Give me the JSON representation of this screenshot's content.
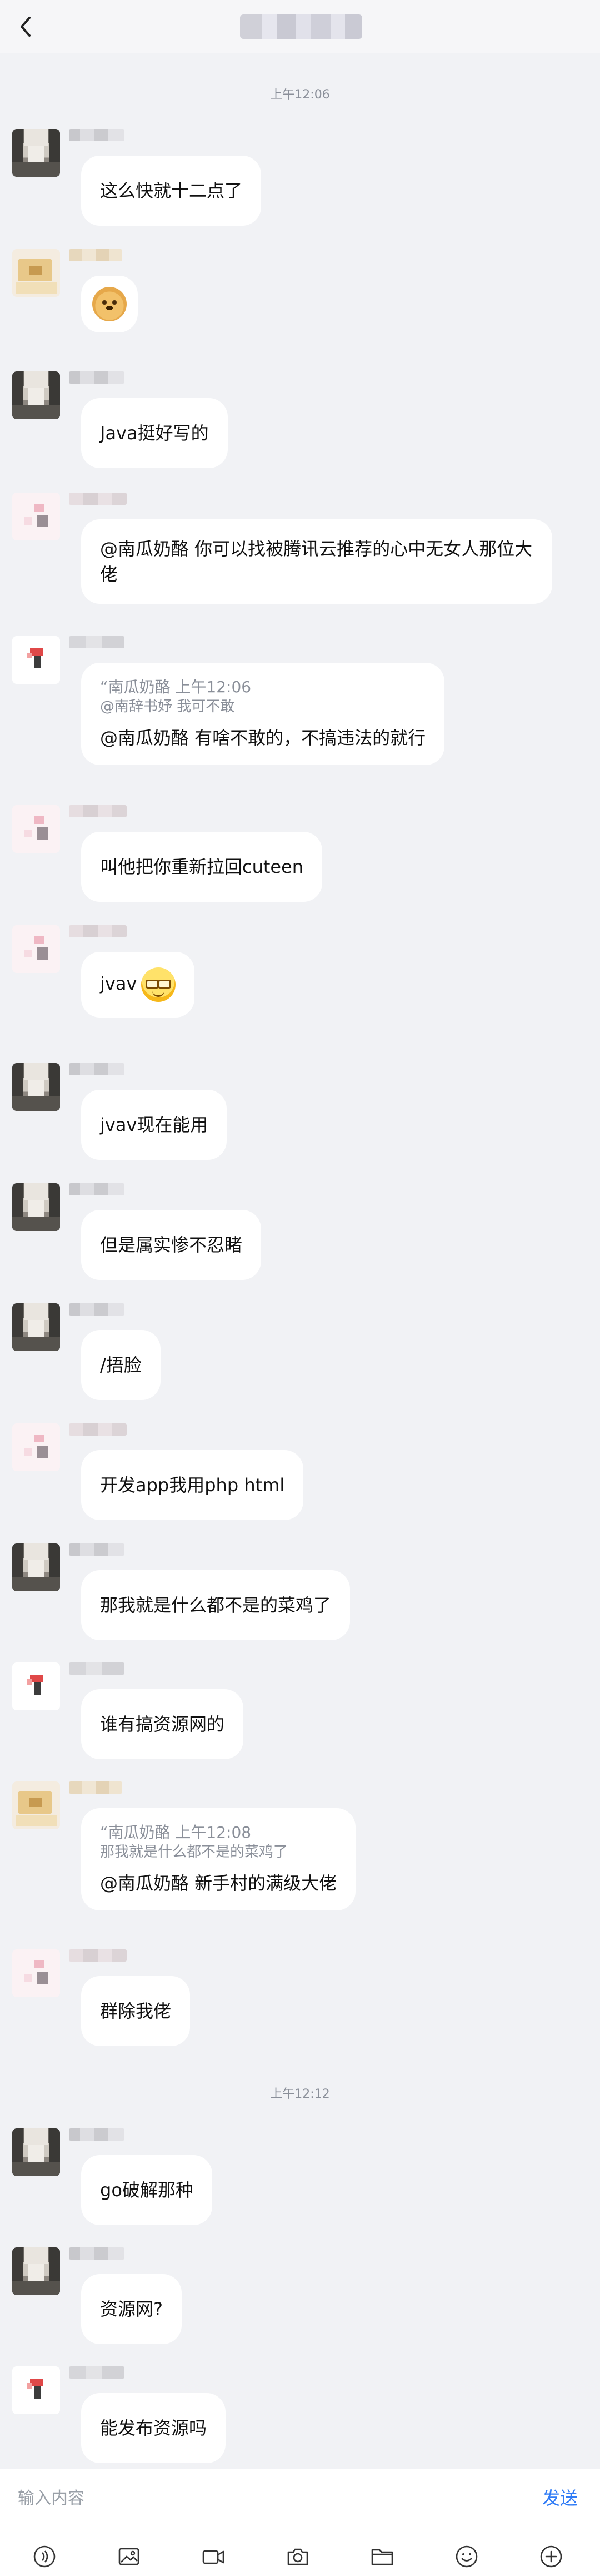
{
  "header": {
    "title": "",
    "back_icon": "chevron-left-icon"
  },
  "time_dividers": [
    "上午12:06",
    "上午12:12"
  ],
  "messages": [
    {
      "avatar": "cat",
      "text": "这么快就十二点了"
    },
    {
      "avatar": "doge",
      "emoji": "doge-emoji"
    },
    {
      "avatar": "cat",
      "text": "Java挺好写的"
    },
    {
      "avatar": "pink",
      "text": "@南瓜奶酪 你可以找被腾讯云推荐的心中无女人那位大佬"
    },
    {
      "avatar": "red",
      "quote_meta": "“南瓜奶酪 上午12:06",
      "quote_sub": "@南辞书妤 我可不敢",
      "text": "@南瓜奶酪 有啥不敢的，不搞违法的就行"
    },
    {
      "avatar": "pink",
      "text": "叫他把你重新拉回cuteen"
    },
    {
      "avatar": "pink",
      "text": "jvav",
      "emoji": "glasses-smile-emoji"
    },
    {
      "avatar": "cat",
      "text": "jvav现在能用"
    },
    {
      "avatar": "cat",
      "text": "但是属实惨不忍睹"
    },
    {
      "avatar": "cat",
      "text": "/捂脸"
    },
    {
      "avatar": "pink",
      "text": "开发app我用php html"
    },
    {
      "avatar": "cat",
      "text": "那我就是什么都不是的菜鸡了"
    },
    {
      "avatar": "red",
      "text": "谁有搞资源网的"
    },
    {
      "avatar": "doge",
      "quote_meta": "“南瓜奶酪 上午12:08",
      "quote_sub": "那我就是什么都不是的菜鸡了",
      "text": "@南瓜奶酪 新手村的满级大佬"
    },
    {
      "avatar": "pink",
      "text": "群除我佬"
    },
    {
      "avatar": "cat",
      "text": "go破解那种"
    },
    {
      "avatar": "cat",
      "text": "资源网?"
    },
    {
      "avatar": "red",
      "text": "能发布资源吗"
    }
  ],
  "input": {
    "placeholder": "输入内容",
    "value": "",
    "send_label": "发送"
  },
  "toolbar": [
    {
      "icon": "voice-icon"
    },
    {
      "icon": "image-icon"
    },
    {
      "icon": "video-icon"
    },
    {
      "icon": "camera-icon"
    },
    {
      "icon": "folder-icon"
    },
    {
      "icon": "emoji-icon"
    },
    {
      "icon": "plus-icon"
    }
  ]
}
